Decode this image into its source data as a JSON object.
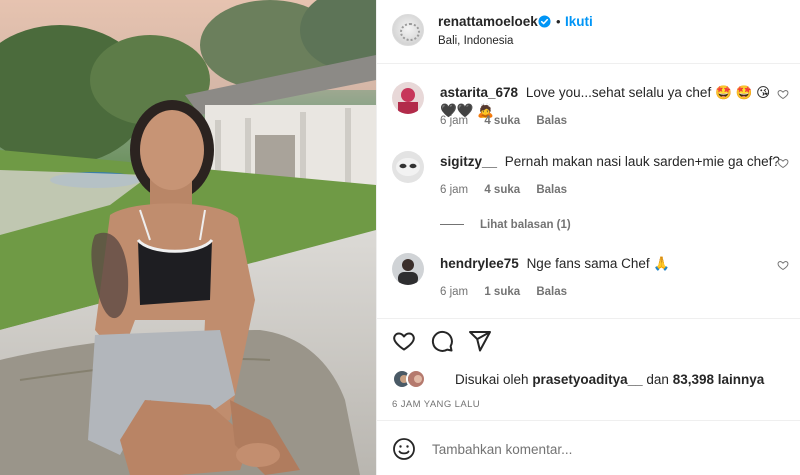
{
  "post": {
    "author": "renattamoeloek",
    "follow_label": "Ikuti",
    "separator": "•",
    "location": "Bali, Indonesia",
    "verified_icon": "verified-badge-icon",
    "photo_alt": "Foto postingan"
  },
  "comments": [
    {
      "username": "astarita_678",
      "text": "Love you...sehat selalu ya chef",
      "emoji": "🤩 🤩 😘 🖤🖤 🙇",
      "time": "6 jam",
      "likes": "4 suka",
      "reply": "Balas"
    },
    {
      "username": "sigitzy__",
      "text": "Pernah makan nasi lauk sarden+mie ga chef?",
      "time": "6 jam",
      "likes": "4 suka",
      "reply": "Balas",
      "view_replies": "Lihat balasan (1)"
    },
    {
      "username": "hendrylee75",
      "text": "Nge fans sama Chef",
      "emoji": "🙏",
      "time": "6 jam",
      "likes": "1 suka",
      "reply": "Balas"
    }
  ],
  "actions": {
    "like_icon": "heart-icon",
    "comment_icon": "comment-icon",
    "share_icon": "share-icon"
  },
  "likes": {
    "prefix": "Disukai oleh",
    "user": "prasetyoaditya__",
    "middle": "dan",
    "count": "83,398",
    "suffix": "lainnya"
  },
  "time_ago": "6 JAM YANG LALU",
  "add_comment": {
    "placeholder": "Tambahkan komentar...",
    "emoji_icon": "emoji-icon"
  },
  "colors": {
    "accent": "#0095f6",
    "text": "#262626",
    "muted": "#737373",
    "divider": "#efefef"
  }
}
